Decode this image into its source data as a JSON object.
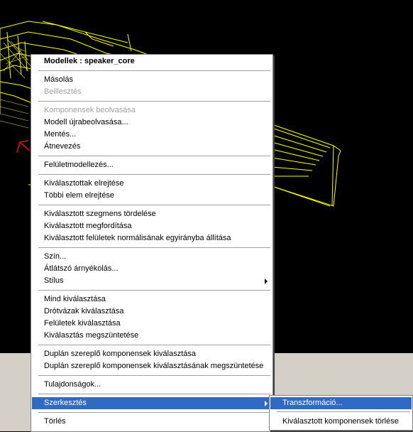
{
  "menu": {
    "title": "Modellek : speaker_core",
    "items": [
      {
        "label": "Másolás",
        "disabled": false
      },
      {
        "label": "Beillesztés",
        "disabled": true
      },
      {
        "label": "Komponensek beolvasása",
        "disabled": true
      },
      {
        "label": "Modell újrabeolvasása...",
        "disabled": false
      },
      {
        "label": "Mentés...",
        "disabled": false
      },
      {
        "label": "Átnevezés",
        "disabled": false
      },
      {
        "label": "Felületmodellezés...",
        "disabled": false
      },
      {
        "label": "Kiválasztottak elrejtése",
        "disabled": false
      },
      {
        "label": "Többi elem elrejtése",
        "disabled": false
      },
      {
        "label": "Kiválasztott szegmens tördelése",
        "disabled": false
      },
      {
        "label": "Kiválasztott megfordítása",
        "disabled": false
      },
      {
        "label": "Kiválasztott felületek normálisának egyirányba állítása",
        "disabled": false
      },
      {
        "label": "Szín...",
        "disabled": false
      },
      {
        "label": "Átlátszó árnyékolás...",
        "disabled": false
      },
      {
        "label": "Stílus",
        "disabled": false,
        "submenu": true
      },
      {
        "label": "Mind kiválasztása",
        "disabled": false
      },
      {
        "label": "Drótvázak kiválasztása",
        "disabled": false
      },
      {
        "label": "Felületek kiválasztása",
        "disabled": false
      },
      {
        "label": "Kiválasztás megszüntetése",
        "disabled": false
      },
      {
        "label": "Duplán szereplő komponensek kiválasztása",
        "disabled": false
      },
      {
        "label": "Duplán szereplő komponensek kiválasztásának megszüntetése",
        "disabled": false
      },
      {
        "label": "Tulajdonságok...",
        "disabled": false
      },
      {
        "label": "Szerkesztés",
        "disabled": false,
        "submenu": true,
        "highlighted": true
      },
      {
        "label": "Törlés",
        "disabled": false
      }
    ]
  },
  "submenu": {
    "items": [
      {
        "label": "Transzformáció...",
        "highlighted": true
      },
      {
        "label": "Kiválasztott komponensek törlése",
        "highlighted": false
      }
    ]
  },
  "colors": {
    "viewport_background": "#000000",
    "wireframe": "#ffff00",
    "axis": "#ff0000",
    "menu_highlight": "#316ac5",
    "panel": "#d4d0c8"
  }
}
